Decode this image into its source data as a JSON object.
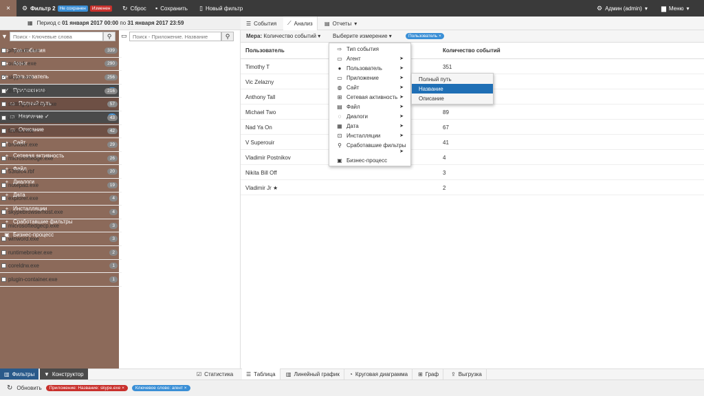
{
  "topbar": {
    "close": "×",
    "filter_title": "Фильтр 2",
    "badge_unsaved": "Не сохранен",
    "badge_changed": "Изменен",
    "reset": "Сброс",
    "save": "Сохранить",
    "new_filter": "Новый фильтр",
    "admin": "Админ (admin)",
    "menu": "Меню"
  },
  "period": {
    "prefix": "Период с",
    "from": "01 января 2017 00:00",
    "mid": "по",
    "to": "31 января 2017 23:59"
  },
  "left": {
    "search_placeholder": "Поиск - Ключевые слова",
    "items": [
      {
        "label": "Тип события",
        "icon": "⇨"
      },
      {
        "label": "Агент",
        "icon": "+"
      },
      {
        "label": "Пользователь",
        "icon": "+"
      },
      {
        "label": "Приложение",
        "icon": "✓",
        "count": "1"
      },
      {
        "label": "Полный путь",
        "icon": "▭"
      },
      {
        "label": "Название ✓",
        "icon": "▭",
        "count": "1"
      },
      {
        "label": "Описание",
        "icon": "▭"
      },
      {
        "label": "Сайт",
        "icon": "+"
      },
      {
        "label": "Сетевая активность",
        "icon": "+"
      },
      {
        "label": "Файл",
        "icon": "+"
      },
      {
        "label": "Диалоги",
        "icon": "+"
      },
      {
        "label": "Дата",
        "icon": "+"
      },
      {
        "label": "Инсталляции",
        "icon": "+"
      },
      {
        "label": "Сработавшие фильтры",
        "icon": "+"
      },
      {
        "label": "Бизнес-процесс",
        "icon": "▣"
      }
    ]
  },
  "mid": {
    "search_placeholder": "Поиск - Приложение. Название",
    "apps": [
      {
        "name": "phpxedit.exe",
        "count": "339",
        "checked": ""
      },
      {
        "name": "outlook.exe",
        "count": "290",
        "checked": ""
      },
      {
        "name": "skype.exe",
        "count": "256",
        "checked": "✓"
      },
      {
        "name": "thunderbird.exe",
        "count": "216",
        "checked": ""
      },
      {
        "name": "settingsynchost.exe",
        "count": "57",
        "checked": ""
      },
      {
        "name": "chrome.exe",
        "count": "43",
        "checked": ""
      },
      {
        "name": "firefox.exe",
        "count": "42",
        "checked": ""
      },
      {
        "name": "browser.exe",
        "count": "29",
        "checked": ""
      },
      {
        "name": "microsoftedge.exe",
        "count": "26",
        "checked": ""
      },
      {
        "name": "53fdfc4.rbf",
        "count": "20",
        "checked": ""
      },
      {
        "name": "notepad.exe",
        "count": "19",
        "checked": ""
      },
      {
        "name": "explorer.exe",
        "count": "4",
        "checked": ""
      },
      {
        "name": "skypebrowserhost.exe",
        "count": "4",
        "checked": ""
      },
      {
        "name": "microsoftedgecp.exe",
        "count": "3",
        "checked": ""
      },
      {
        "name": "winword.exe",
        "count": "3",
        "checked": ""
      },
      {
        "name": "runtimebroker.exe",
        "count": "2",
        "checked": ""
      },
      {
        "name": "coreldrw.exe",
        "count": "1",
        "checked": ""
      },
      {
        "name": "plugin-container.exe",
        "count": "1",
        "checked": ""
      }
    ]
  },
  "right_tabs": {
    "events": "События",
    "analysis": "Анализ",
    "reports": "Отчеты"
  },
  "measure": {
    "label": "Мера:",
    "value": "Количество событий",
    "dimension": "Выберите измерение",
    "user_badge": "Пользователь ×"
  },
  "table": {
    "col_user": "Пользователь",
    "col_count": "Количество событий",
    "rows": [
      {
        "user": "Timothy T",
        "count": "351"
      },
      {
        "user": "Vic Zelazny",
        "count": ""
      },
      {
        "user": "Anthony Tall",
        "count": ""
      },
      {
        "user": "Michael Two",
        "count": "89"
      },
      {
        "user": "Nad Ya On",
        "count": "67"
      },
      {
        "user": "V Superouir",
        "count": "41"
      },
      {
        "user": "Vladimir Postnikov",
        "count": "4"
      },
      {
        "user": "Nikita Bill Off",
        "count": "3"
      },
      {
        "user": "Vladimir Jr ★",
        "count": "2"
      }
    ]
  },
  "dropdown": {
    "items": [
      {
        "label": "Тип события",
        "icon": "⇨",
        "arrow": ""
      },
      {
        "label": "Агент",
        "icon": "▭",
        "arrow": "➤"
      },
      {
        "label": "Пользователь",
        "icon": "●",
        "arrow": "➤"
      },
      {
        "label": "Приложение",
        "icon": "▭",
        "arrow": "➤"
      },
      {
        "label": "Сайт",
        "icon": "◍",
        "arrow": "➤"
      },
      {
        "label": "Сетевая активность",
        "icon": "⊞",
        "arrow": "➤"
      },
      {
        "label": "Файл",
        "icon": "▤",
        "arrow": "➤"
      },
      {
        "label": "Диалоги",
        "icon": "◌",
        "arrow": "➤"
      },
      {
        "label": "Дата",
        "icon": "▦",
        "arrow": "➤"
      },
      {
        "label": "Инсталляции",
        "icon": "⊡",
        "arrow": "➤"
      },
      {
        "label": "Сработавшие фильтры",
        "icon": "⚲",
        "arrow": ""
      },
      {
        "label": "",
        "icon": "",
        "arrow": "➤"
      },
      {
        "label": "Бизнес-процесс",
        "icon": "▣",
        "arrow": ""
      }
    ]
  },
  "submenu": {
    "items": [
      "Полный путь",
      "Название",
      "Описание"
    ]
  },
  "bottom_left": {
    "filters": "Фильтры",
    "constructor": "Конструктор",
    "stats": "Статистика"
  },
  "bottom_right": {
    "table": "Таблица",
    "line": "Линейный график",
    "pie": "Круговая диаграмма",
    "graph": "Граф",
    "export": "Выгрузка"
  },
  "status": {
    "refresh": "Обновить",
    "chip_app": "Приложение: Название: skype.exe ×",
    "chip_kw": "Ключевое слово: агент ×"
  }
}
